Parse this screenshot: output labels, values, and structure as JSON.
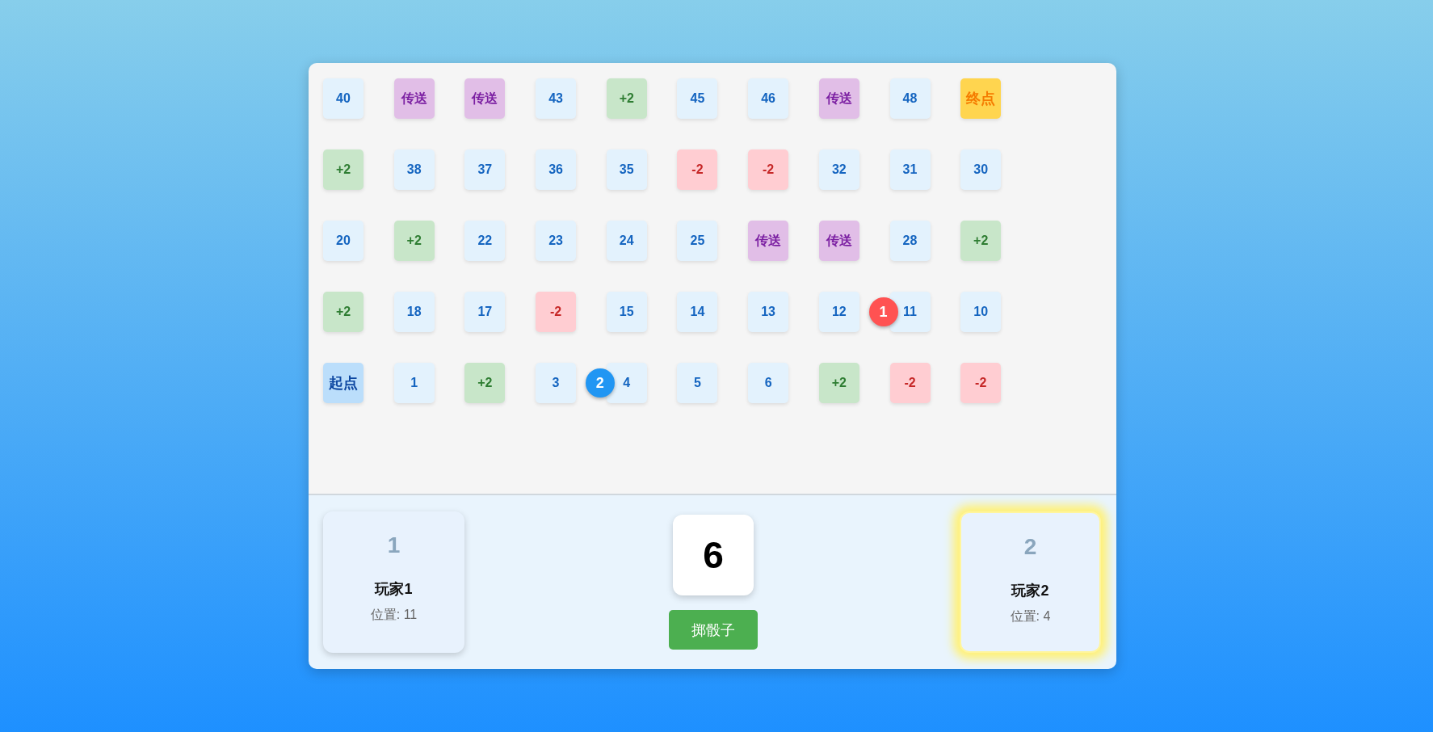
{
  "board": {
    "rows": [
      [
        {
          "label": "40",
          "kind": "normal"
        },
        {
          "label": "传送",
          "kind": "teleport"
        },
        {
          "label": "传送",
          "kind": "teleport"
        },
        {
          "label": "43",
          "kind": "normal"
        },
        {
          "label": "+2",
          "kind": "plus"
        },
        {
          "label": "45",
          "kind": "normal"
        },
        {
          "label": "46",
          "kind": "normal"
        },
        {
          "label": "传送",
          "kind": "teleport"
        },
        {
          "label": "48",
          "kind": "normal"
        },
        {
          "label": "终点",
          "kind": "end"
        }
      ],
      [
        {
          "label": "+2",
          "kind": "plus"
        },
        {
          "label": "38",
          "kind": "normal"
        },
        {
          "label": "37",
          "kind": "normal"
        },
        {
          "label": "36",
          "kind": "normal"
        },
        {
          "label": "35",
          "kind": "normal"
        },
        {
          "label": "-2",
          "kind": "minus"
        },
        {
          "label": "-2",
          "kind": "minus"
        },
        {
          "label": "32",
          "kind": "normal"
        },
        {
          "label": "31",
          "kind": "normal"
        },
        {
          "label": "30",
          "kind": "normal"
        }
      ],
      [
        {
          "label": "20",
          "kind": "normal"
        },
        {
          "label": "+2",
          "kind": "plus"
        },
        {
          "label": "22",
          "kind": "normal"
        },
        {
          "label": "23",
          "kind": "normal"
        },
        {
          "label": "24",
          "kind": "normal"
        },
        {
          "label": "25",
          "kind": "normal"
        },
        {
          "label": "传送",
          "kind": "teleport"
        },
        {
          "label": "传送",
          "kind": "teleport"
        },
        {
          "label": "28",
          "kind": "normal"
        },
        {
          "label": "+2",
          "kind": "plus"
        }
      ],
      [
        {
          "label": "+2",
          "kind": "plus"
        },
        {
          "label": "18",
          "kind": "normal"
        },
        {
          "label": "17",
          "kind": "normal"
        },
        {
          "label": "-2",
          "kind": "minus"
        },
        {
          "label": "15",
          "kind": "normal"
        },
        {
          "label": "14",
          "kind": "normal"
        },
        {
          "label": "13",
          "kind": "normal"
        },
        {
          "label": "12",
          "kind": "normal"
        },
        {
          "label": "11",
          "kind": "normal",
          "tokens": [
            {
              "label": "1",
              "color": "#ff5252"
            }
          ]
        },
        {
          "label": "10",
          "kind": "normal"
        }
      ],
      [
        {
          "label": "起点",
          "kind": "start"
        },
        {
          "label": "1",
          "kind": "normal"
        },
        {
          "label": "+2",
          "kind": "plus"
        },
        {
          "label": "3",
          "kind": "normal"
        },
        {
          "label": "4",
          "kind": "normal",
          "tokens": [
            {
              "label": "2",
              "color": "#2196f3"
            }
          ]
        },
        {
          "label": "5",
          "kind": "normal"
        },
        {
          "label": "6",
          "kind": "normal"
        },
        {
          "label": "+2",
          "kind": "plus"
        },
        {
          "label": "-2",
          "kind": "minus"
        },
        {
          "label": "-2",
          "kind": "minus"
        }
      ]
    ]
  },
  "players": [
    {
      "number": "1",
      "name": "玩家1",
      "position": "位置: 11",
      "selected": false
    },
    {
      "number": "2",
      "name": "玩家2",
      "position": "位置: 4",
      "selected": true
    }
  ],
  "dice": {
    "value": "6",
    "button": "掷骰子"
  }
}
